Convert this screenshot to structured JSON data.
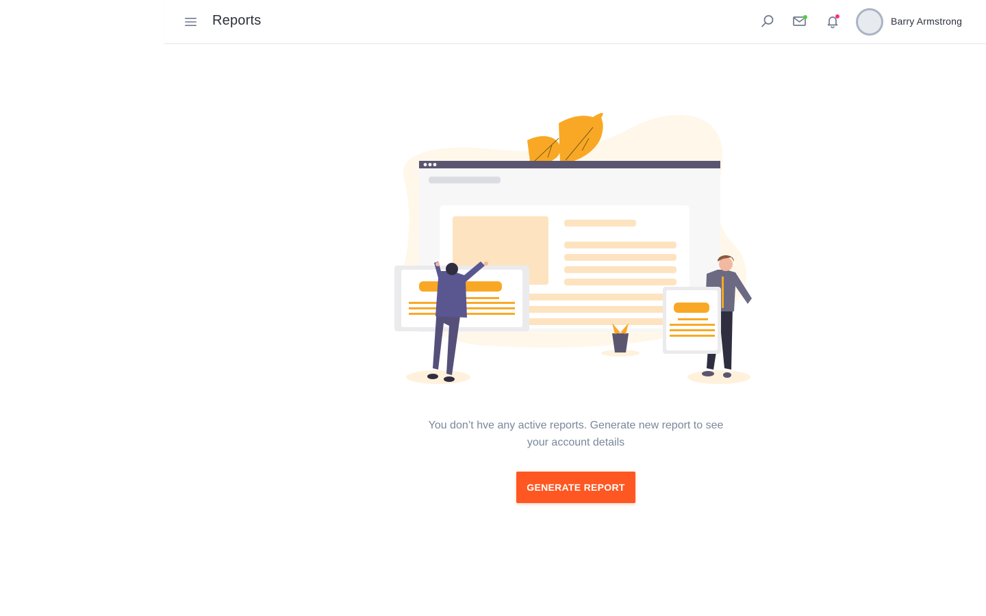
{
  "header": {
    "title": "Reports",
    "user_name": "Barry Armstrong",
    "icons": [
      "menu-icon",
      "search-icon",
      "mail-icon",
      "bell-icon"
    ],
    "mail_indicator_color": "#4cd137",
    "notification_indicator_color": "#ff2d7a"
  },
  "empty_state": {
    "message": "You don’t hve any active reports. Generate new report to see your account details",
    "button_label": "GENERATE REPORT",
    "button_color": "#ff5722",
    "accent_color": "#f9a825"
  }
}
